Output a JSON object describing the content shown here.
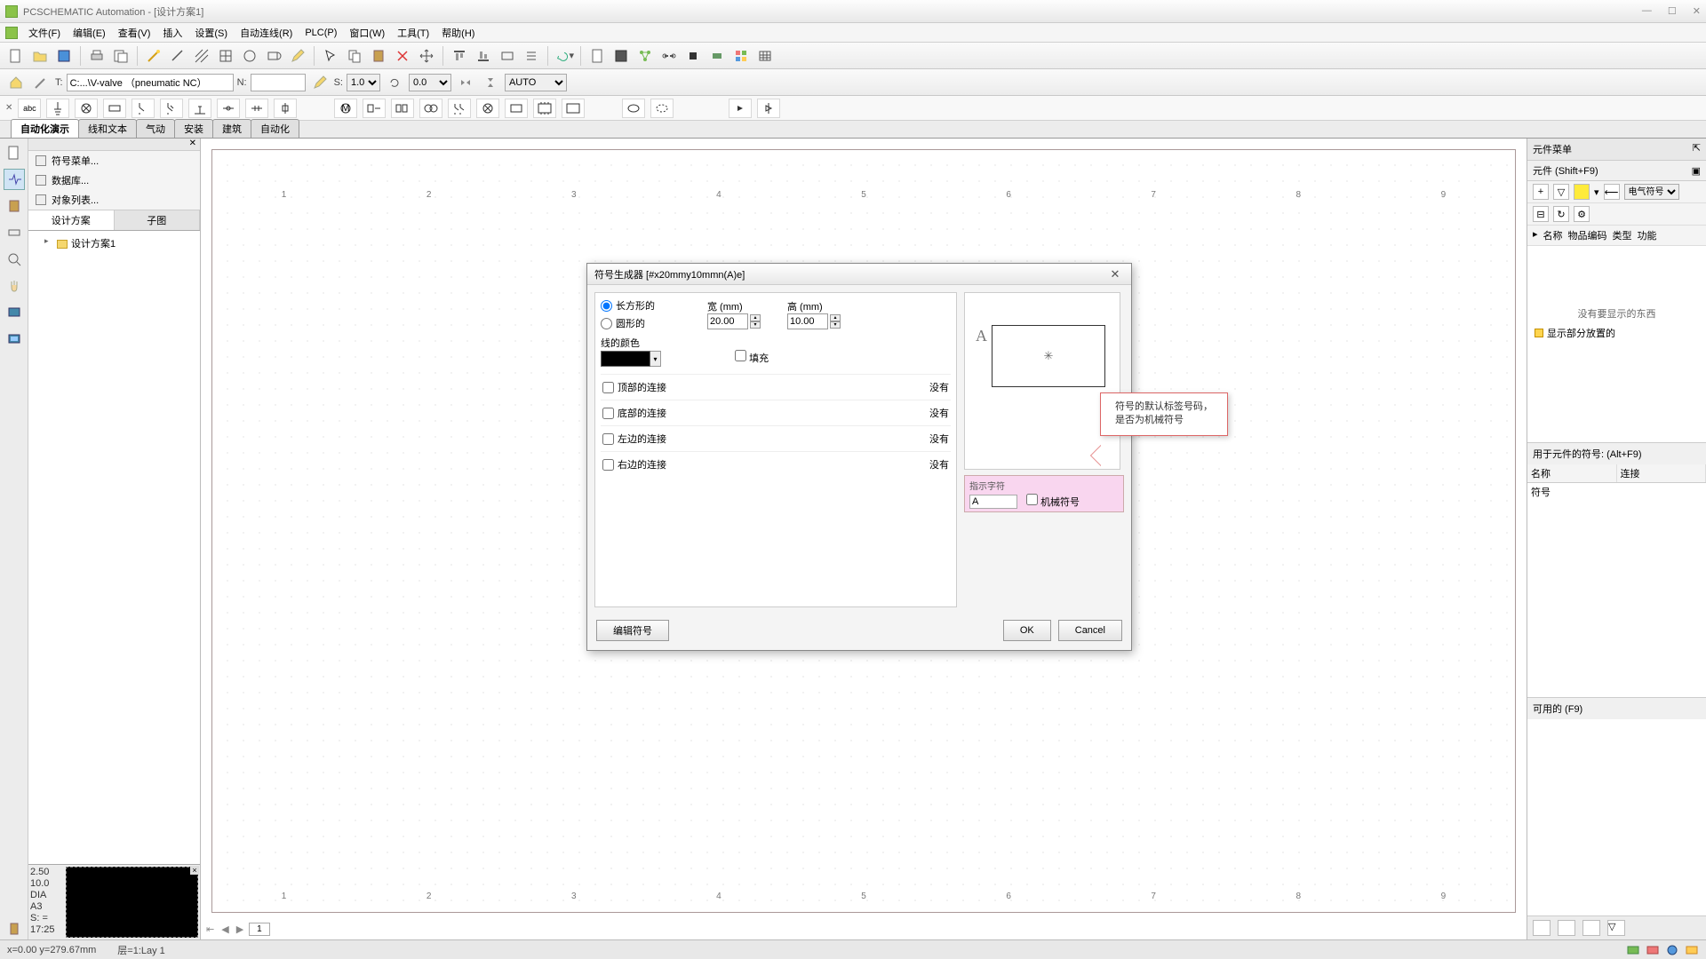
{
  "title": "PCSCHEMATIC Automation - [设计方案1]",
  "menu": [
    "文件(F)",
    "编辑(E)",
    "查看(V)",
    "插入",
    "设置(S)",
    "自动连线(R)",
    "PLC(P)",
    "窗口(W)",
    "工具(T)",
    "帮助(H)"
  ],
  "toolbar2": {
    "t_label": "T:",
    "t_value": "C:...\\V-valve （pneumatic NC）",
    "n_label": "N:",
    "n_value": "",
    "s_label": "S:",
    "s_value": "1.0",
    "r_label": "",
    "r_value": "0.0",
    "auto": "AUTO"
  },
  "pagetabs": [
    "自动化演示",
    "线和文本",
    "气动",
    "安装",
    "建筑",
    "自动化"
  ],
  "active_pagetab": 0,
  "left_menu": [
    "符号菜单...",
    "数据库...",
    "对象列表..."
  ],
  "left_tabs": [
    "设计方案",
    "子图"
  ],
  "tree": {
    "root": "设计方案1"
  },
  "left_info": [
    "2.50",
    "10.0",
    "DIA",
    "A3",
    "S: =",
    "17:25"
  ],
  "rulers": [
    "1",
    "2",
    "3",
    "4",
    "5",
    "6",
    "7",
    "8",
    "9"
  ],
  "bottom_page": "1",
  "right": {
    "title": "元件菜单",
    "sub": "元件 (Shift+F9)",
    "dropdown": "电气符号",
    "cols": [
      "名称",
      "物品编码",
      "类型",
      "功能"
    ],
    "nodata": "没有要显示的东西",
    "chk": "显示部分放置的",
    "sect2": "用于元件的符号: (Alt+F9)",
    "col2a": "名称",
    "col2b": "连接",
    "row2": "符号",
    "sect3": "可用的 (F9)"
  },
  "dialog": {
    "title": "符号生成器  [#x20mmy10mmn(A)e]",
    "shape_rect": "长方形的",
    "shape_round": "圆形的",
    "width_lbl": "宽 (mm)",
    "width_val": "20.00",
    "height_lbl": "高 (mm)",
    "height_val": "10.00",
    "color_lbl": "线的颜色",
    "fill_lbl": "填充",
    "conns": [
      {
        "label": "顶部的连接",
        "state": "没有"
      },
      {
        "label": "底部的连接",
        "state": "没有"
      },
      {
        "label": "左边的连接",
        "state": "没有"
      },
      {
        "label": "右边的连接",
        "state": "没有"
      }
    ],
    "indicator_lbl": "指示字符",
    "indicator_val": "A",
    "mech_lbl": "机械符号",
    "edit_btn": "编辑符号",
    "ok": "OK",
    "cancel": "Cancel"
  },
  "callout": {
    "line1": "符号的默认标签号码，",
    "line2": "是否为机械符号"
  },
  "status": {
    "coords": "x=0.00 y=279.67mm",
    "layer": "层=1:Lay 1"
  }
}
